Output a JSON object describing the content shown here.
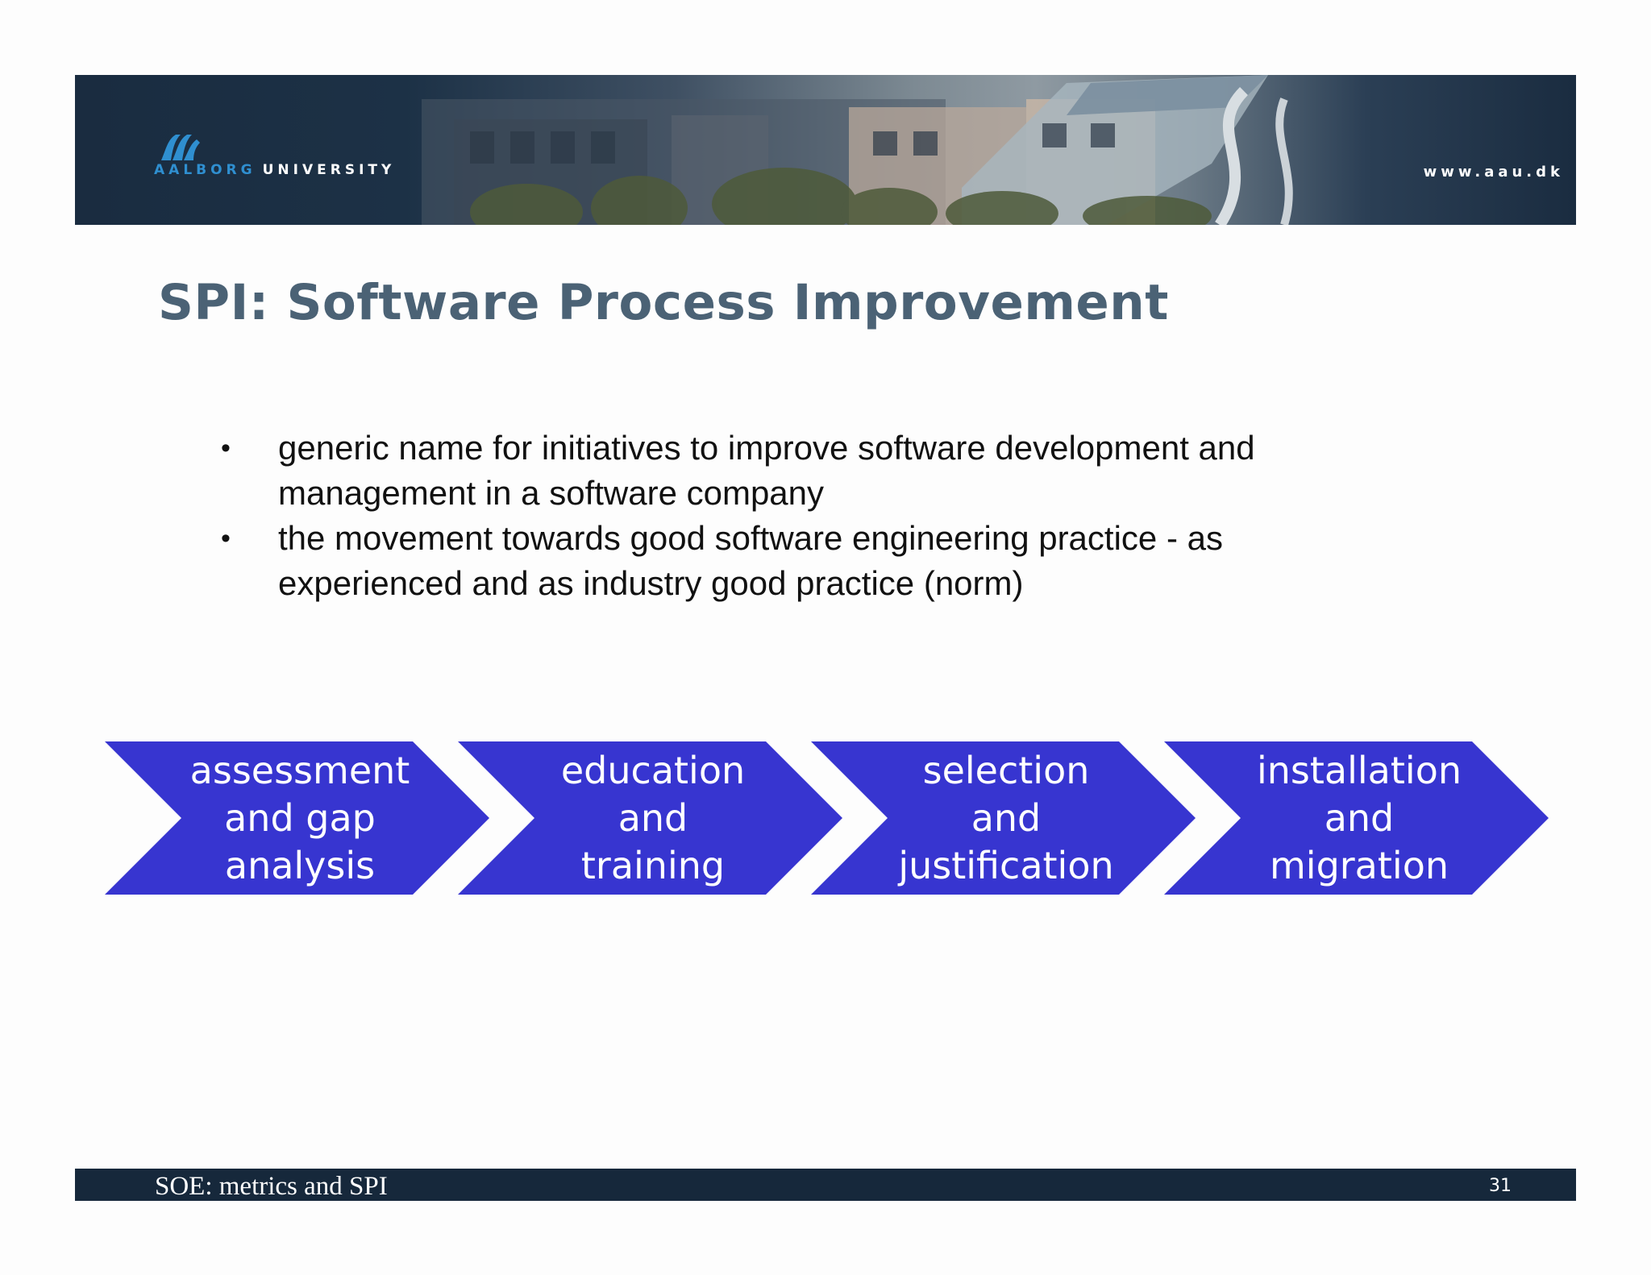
{
  "header": {
    "logo_text_part1": "AALBORG",
    "logo_text_part2": "UNIVERSITY",
    "url": "www.aau.dk"
  },
  "slide": {
    "title": "SPI: Software Process Improvement",
    "bullets": [
      {
        "line1": "generic name for initiatives to improve software development and",
        "line2": "management in a software company"
      },
      {
        "line1": "the movement towards good software engineering practice - as",
        "line2": "experienced and as industry good practice (norm)"
      }
    ],
    "process_steps": [
      {
        "lines": [
          "assessment",
          "and gap",
          "analysis"
        ]
      },
      {
        "lines": [
          "education",
          "and",
          "training"
        ]
      },
      {
        "lines": [
          "selection",
          "and",
          "justification"
        ]
      },
      {
        "lines": [
          "installation",
          "and",
          "migration"
        ]
      }
    ]
  },
  "footer": {
    "text": "SOE: metrics and SPI",
    "page_number": "31"
  },
  "colors": {
    "banner_navy": "#1a2c40",
    "title": "#4b6275",
    "chevron_blue": "#3735d0",
    "logo_blue": "#2f8fd0",
    "footer": "#16283b"
  },
  "icons": {
    "logo": "aau-wave-logo-icon",
    "bullet": "bullet-dot-icon"
  }
}
